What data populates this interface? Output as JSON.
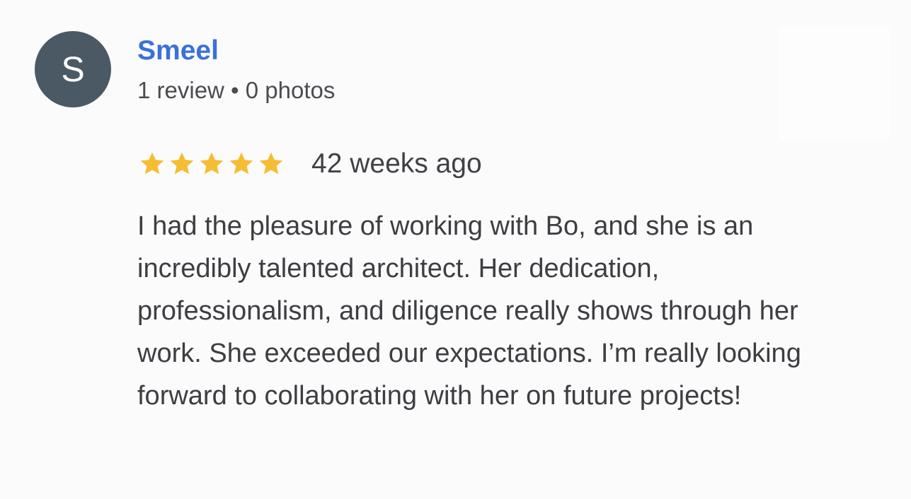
{
  "reviewer": {
    "initial": "S",
    "avatar_color": "#4b5964",
    "name": "Smeel",
    "name_color": "#3a71d9",
    "meta": "1 review • 0 photos"
  },
  "rating": {
    "stars": 5,
    "max_stars": 5,
    "star_color": "#f5bd33",
    "icon": "star-icon"
  },
  "timestamp": "42 weeks ago",
  "review_text": "I had the pleasure of working with Bo, and she is an incredibly talented architect. Her dedication, professionalism, and diligence really shows through her work. She exceeded our expectations. I’m really looking forward to collaborating with her on future projects!"
}
